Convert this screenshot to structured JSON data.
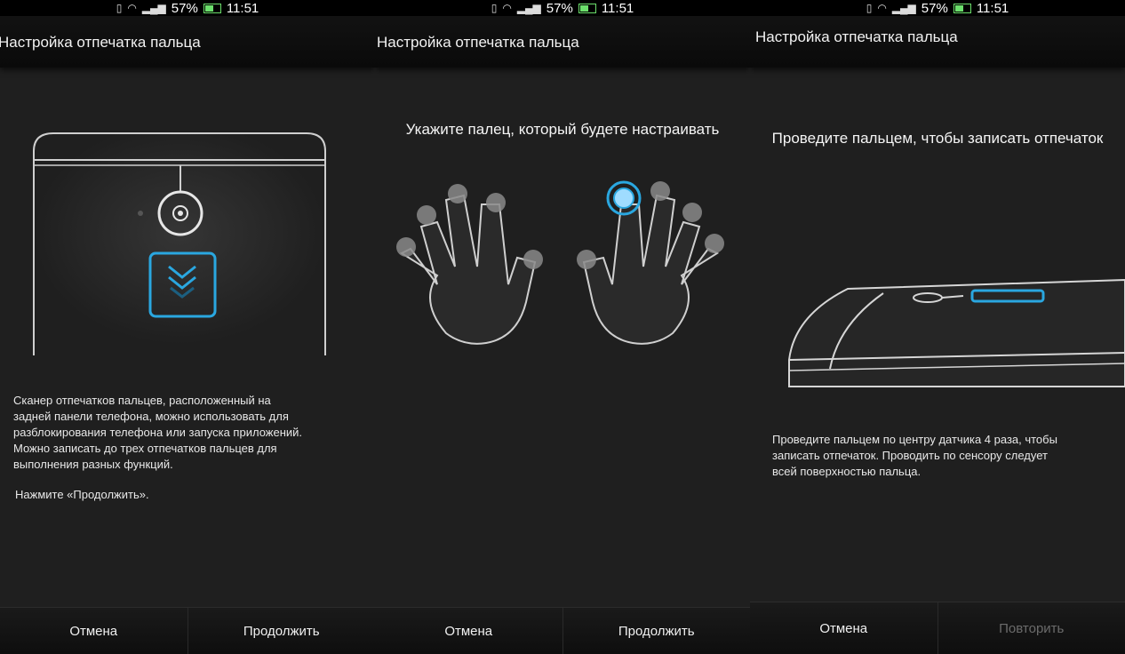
{
  "status": {
    "battery": "57%",
    "time": "11:51"
  },
  "screens": [
    {
      "title": "Настройка отпечатка пальца",
      "paragraph1_lines": [
        "Сканер отпечатков пальцев, расположенный на",
        "задней панели телефона, можно использовать для",
        "разблокирования телефона или запуска приложений.",
        "Можно записать до трех отпечатков пальцев для",
        "выполнения разных функций."
      ],
      "paragraph2": "Нажмите «Продолжить».",
      "cancel_label": "Отмена",
      "continue_label": "Продолжить"
    },
    {
      "title": "Настройка отпечатка пальца",
      "heading": "Укажите палец, который будете настраивать",
      "cancel_label": "Отмена",
      "continue_label": "Продолжить"
    },
    {
      "title": "Настройка отпечатка пальца",
      "heading": "Проведите пальцем, чтобы записать отпечаток",
      "paragraph_lines": [
        "Проведите пальцем по центру датчика 4 раза, чтобы",
        "записать отпечаток. Проводить по сенсору следует",
        "всей поверхностью пальца."
      ],
      "cancel_label": "Отмена",
      "retry_label": "Повторить"
    }
  ],
  "colors": {
    "accent": "#2aa7e0",
    "background": "#1f1f1f",
    "bar": "#0b0b0b"
  }
}
